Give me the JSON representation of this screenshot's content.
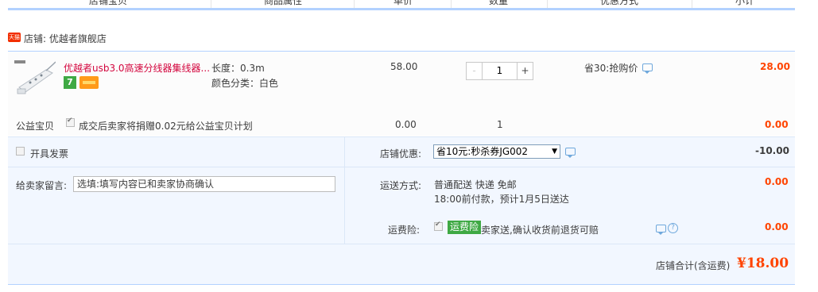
{
  "table_header": {
    "columns": [
      "店铺宝贝",
      "商品属性",
      "单价",
      "数量",
      "优惠方式",
      "小计"
    ]
  },
  "shop": {
    "badge": "天猫",
    "label": "店铺: 优越者旗舰店"
  },
  "item": {
    "title": "优越者usb3.0高速分线器集线器...",
    "sku_length": "长度：0.3m",
    "sku_color": "颜色分类：白色",
    "price": "58.00",
    "quantity": "1",
    "qty_minus": "-",
    "qty_plus": "+",
    "promo": "省30:抢购价",
    "subtotal": "28.00",
    "service_badge": "7"
  },
  "charity": {
    "label": "公益宝贝",
    "text": "成交后卖家将捐赠0.02元给公益宝贝计划",
    "checked": true,
    "price": "0.00",
    "quantity": "1",
    "subtotal": "0.00"
  },
  "invoice": {
    "label": "开具发票",
    "checked": false
  },
  "shop_discount": {
    "label": "店铺优惠:",
    "selected": "省10元:秒杀券JG002",
    "amount": "-10.00"
  },
  "message": {
    "label": "给卖家留言:",
    "placeholder": "选填:填写内容已和卖家协商确认"
  },
  "shipping": {
    "label": "运送方式:",
    "method": "普通配送 快递 免邮",
    "eta": "18:00前付款，预计1月5日送达",
    "amount": "0.00"
  },
  "insurance": {
    "label": "运费险:",
    "badge": "运费险",
    "text": "卖家送,确认收货前退货可赔",
    "checked": true,
    "amount": "0.00"
  },
  "total": {
    "label": "店铺合计(含运费)",
    "amount": "¥18.00"
  },
  "colors": {
    "accent_red": "#f40",
    "title_red": "#d3063e",
    "border_blue": "#b2d1ff",
    "panel_bg": "#f2f7ff",
    "insurance_green": "#3fa944"
  }
}
